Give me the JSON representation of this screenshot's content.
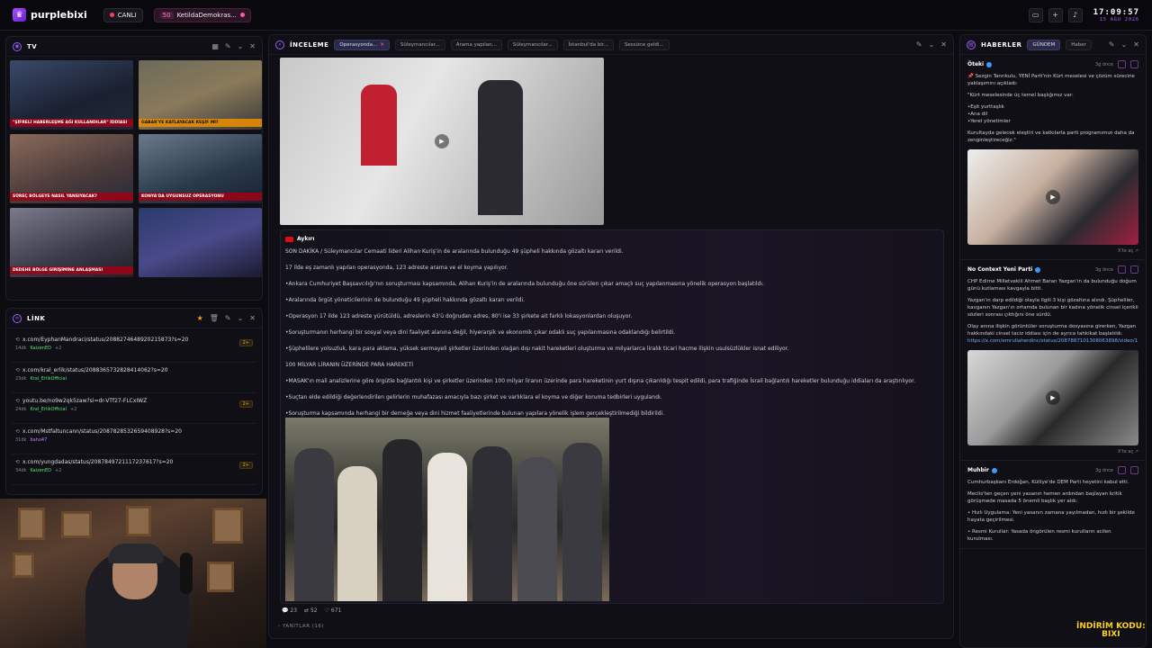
{
  "topbar": {
    "brand": "purplebixi",
    "live_label": "CANLI",
    "topic_count": "50",
    "topic_label": "KetildaDemokras...",
    "clock_time": "17:09:57",
    "clock_date": "15 AĞU 2026"
  },
  "tv": {
    "title": "TV",
    "captions": [
      "\"ŞİFRELİ HABERLEŞME AĞI KULLANDILAR\" İDDİASI",
      "GABAR'YE KATLAYACAK KEŞİF Mİ?",
      "SÜREÇ BÖLGEYE NASIL YANSIYACAK?",
      "KONYA'DA UYGUNSUZ OPERASYONU",
      "DEDEHE BÖLGE GİRİŞİMİNE ANLAŞMASI",
      ""
    ]
  },
  "link": {
    "title": "LİNK",
    "items": [
      {
        "url": "x.com/EyphanMandraci/status/2088274648920215873?s=20",
        "age": "14dk",
        "user": "KaizenED",
        "extra": "+2",
        "badge": "2+"
      },
      {
        "url": "x.com/kral_erlik/status/2088365732828414062?s=20",
        "age": "23dk",
        "user": "Kral_ErlikOfficial",
        "extra": "",
        "badge": ""
      },
      {
        "url": "youtu.be/no9w2qk5zaw?si=dr-VTf27-FLCxIWZ",
        "age": "24dk",
        "user": "Kral_ErlikOfficial",
        "extra": "+2",
        "badge": "2+"
      },
      {
        "url": "x.com/Mstfaltuncann/status/2087828532659408928?s=20",
        "age": "31dk",
        "user": "baho47",
        "extra": "",
        "badge": ""
      },
      {
        "url": "x.com/yungdadas/status/2087849721117237617?s=20",
        "age": "34dk",
        "user": "KaizenED",
        "extra": "+2",
        "badge": "2+"
      }
    ]
  },
  "inceleme": {
    "title": "İNCELEME",
    "tabs": [
      "Operasyonda...",
      "Süleymancılar...",
      "Arama yapılan...",
      "Süleymancılar...",
      "İstanbul'da bir...",
      "Sessizce geldi..."
    ],
    "author": "Aykırı",
    "paragraphs": [
      "SON DAKİKA / Süleymancılar Cemaati lideri Alihan Kuriş'in de aralarında bulunduğu 49 şüpheli hakkında gözaltı kararı verildi.",
      "17 ilde eş zamanlı yapılan operasyonda, 123 adreste arama ve el koyma yapılıyor.",
      "•Ankara Cumhuriyet Başsavcılığı'nın soruşturması kapsamında, Alihan Kuriş'in de aralarında bulunduğu öne sürülen çıkar amaçlı suç yapılanmasına yönelik operasyon başlatıldı.",
      "•Aralarında örgüt yöneticilerinin de bulunduğu 49 şüpheli hakkında gözaltı kararı verildi.",
      "•Operasyon 17 ilde 123 adreste yürütüldü, adreslerin 43'ü doğrudan adres, 80'i ise 33 şirkete ait farklı lokasyonlardan oluşuyor.",
      "•Soruşturmanın herhangi bir sosyal veya dini faaliyet alanına değil, hiyerarşik ve ekonomik çıkar odaklı suç yapılanmasına odaklandığı belirtildi.",
      "•Şüphelilere yolsuzluk, kara para aklama, yüksek sermayeli şirketler üzerinden olağan dışı nakit hareketleri oluşturma ve milyarlarca liralık ticari hacme ilişkin usulsüzlükler isnat ediliyor.",
      "100 MİLYAR LİRANIN ÜZERİNDE PARA HAREKETİ",
      "•MASAK'ın mali analizlerine göre örgütle bağlantılı kişi ve şirketler üzerinden 100 milyar liranın üzerinde para hareketinin yurt dışına çıkarıldığı tespit edildi, para trafiğinde İsrail bağlantılı hareketler bulunduğu iddiaları da araştırılıyor.",
      "•Suçtan elde edildiği değerlendirilen gelirlerin muhafazası amacıyla bazı şirket ve varlıklara el koyma ve diğer koruma tedbirleri uygulandı.",
      "•Soruşturma kapsamında herhangi bir derneğe veya dini hizmet faaliyetlerinde bulunan yapılara yönelik işlem gerçekleştirilmediği bildirildi."
    ],
    "comments": "23",
    "reposts": "52",
    "likes": "671",
    "replies_label": "YANITLAR (16)"
  },
  "haberler": {
    "title": "HABERLER",
    "tab_active": "GÜNDEM",
    "tab_other": "Haber",
    "items": [
      {
        "source": "Öteki",
        "ago": "3g önce",
        "paragraphs": [
          "📌 Sezgin Tanrıkulu, YENİ Parti'nin Kürt meselesi ve çözüm sürecine yaklaşımını açıkladı:",
          "\"Kürt meselesinde üç temel başlığımız var:",
          "•Eşit yurttaşlık\n•Ana dil\n•Yerel yönetimler",
          "Kurultayda gelecek eleştiri ve katkılarla parti programımızı daha da zenginleştireceğiz.\""
        ],
        "xlink": "X'te aç ↗"
      },
      {
        "source": "No Context Yeni Parti",
        "ago": "3g önce",
        "paragraphs": [
          "CHP Edirne Milletvekili Ahmet Baran Yazgan'ın da bulunduğu doğum günü kutlaması kavgayla bitti.",
          "Yazgan'ın darp edildiği olayla ilgili 3 kişi gözaltına alındı. Şüpheliler, kavganın Yazgan'ın ortamda bulunan bir kadına yönelik cinsel içerikli sözleri sonrası çıktığını öne sürdü.",
          "Olay anına ilişkin görüntüler soruşturma dosyasına girerken, Yazgan hakkındaki cinsel taciz iddiası için de ayrıca tahkikat başlatıldı."
        ],
        "link": "https://x.com/emrullaherdinc/status/2087887101308063898/video/1",
        "xlink": "X'te aç ↗"
      },
      {
        "source": "Muhbir",
        "ago": "3g önce",
        "paragraphs": [
          "Cumhurbaşkanı Erdoğan, Külliye'de DEM Parti heyetini kabul etti.",
          "Meclis'ten geçen yeni yasanın hemen ardından başlayan kritik görüşmede masada 5 önemli başlık yer aldı:",
          "• Hızlı Uygulama: Yeni yasanın zamana yayılmadan, hızlı bir şekilde hayata geçirilmesi.",
          "• Resmi Kurullar: Yasada öngörülen resmi kurulların acilen kurulması."
        ]
      }
    ]
  },
  "promo": {
    "line1": "İNDİRİM KODU:",
    "line2": "BIXI"
  }
}
